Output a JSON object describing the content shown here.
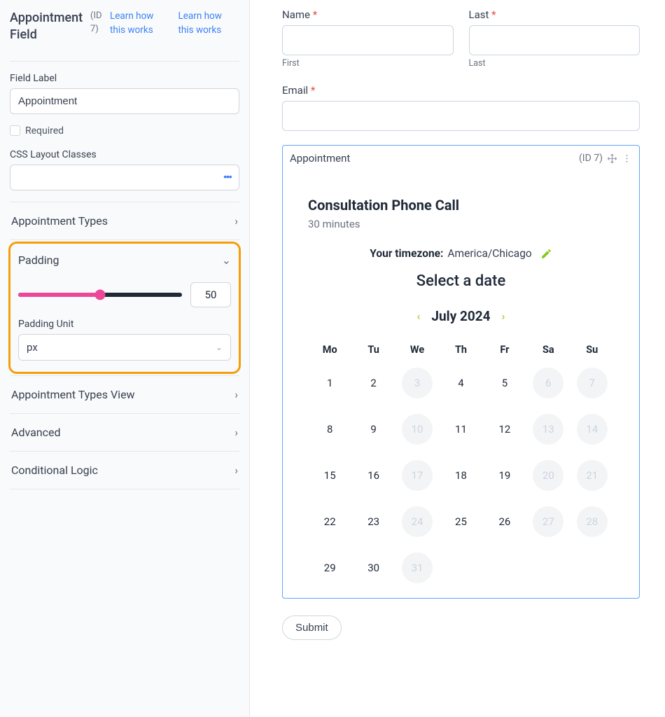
{
  "sidebar": {
    "title": "Appointment Field",
    "id_label": "(ID 7)",
    "learn_link_1": "Learn how this works",
    "learn_link_2": "Learn how this works",
    "field_label_heading": "Field Label",
    "field_label_value": "Appointment",
    "required_label": "Required",
    "css_heading": "CSS Layout Classes",
    "accordion": {
      "appointment_types": "Appointment Types",
      "padding": "Padding",
      "padding_value": "50",
      "padding_unit_label": "Padding Unit",
      "padding_unit_value": "px",
      "appointment_types_view": "Appointment Types View",
      "advanced": "Advanced",
      "conditional_logic": "Conditional Logic"
    }
  },
  "form": {
    "name_label": "Name",
    "last_label": "Last",
    "first_sub": "First",
    "last_sub": "Last",
    "email_label": "Email",
    "submit": "Submit"
  },
  "appointment": {
    "header_left": "Appointment",
    "header_right": "(ID 7)",
    "title": "Consultation Phone Call",
    "duration": "30 minutes",
    "tz_label": "Your timezone:",
    "tz_value": "America/Chicago",
    "select_date": "Select a date",
    "month": "July 2024",
    "weekdays": [
      "Mo",
      "Tu",
      "We",
      "Th",
      "Fr",
      "Sa",
      "Su"
    ],
    "days": [
      {
        "n": "1",
        "d": false
      },
      {
        "n": "2",
        "d": false
      },
      {
        "n": "3",
        "d": true
      },
      {
        "n": "4",
        "d": false
      },
      {
        "n": "5",
        "d": false
      },
      {
        "n": "6",
        "d": true
      },
      {
        "n": "7",
        "d": true
      },
      {
        "n": "8",
        "d": false
      },
      {
        "n": "9",
        "d": false
      },
      {
        "n": "10",
        "d": true
      },
      {
        "n": "11",
        "d": false
      },
      {
        "n": "12",
        "d": false
      },
      {
        "n": "13",
        "d": true
      },
      {
        "n": "14",
        "d": true
      },
      {
        "n": "15",
        "d": false
      },
      {
        "n": "16",
        "d": false
      },
      {
        "n": "17",
        "d": true
      },
      {
        "n": "18",
        "d": false
      },
      {
        "n": "19",
        "d": false
      },
      {
        "n": "20",
        "d": true
      },
      {
        "n": "21",
        "d": true
      },
      {
        "n": "22",
        "d": false
      },
      {
        "n": "23",
        "d": false
      },
      {
        "n": "24",
        "d": true
      },
      {
        "n": "25",
        "d": false
      },
      {
        "n": "26",
        "d": false
      },
      {
        "n": "27",
        "d": true
      },
      {
        "n": "28",
        "d": true
      },
      {
        "n": "29",
        "d": false
      },
      {
        "n": "30",
        "d": false
      },
      {
        "n": "31",
        "d": true
      }
    ]
  }
}
